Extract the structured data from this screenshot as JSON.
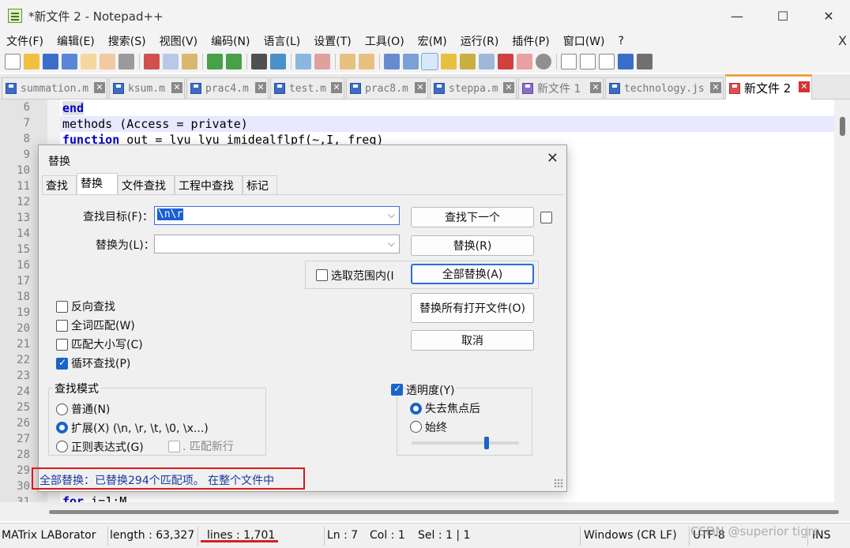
{
  "window": {
    "title": "*新文件 2 - Notepad++",
    "minimize": "—",
    "maximize": "☐",
    "close": "✕"
  },
  "menu": {
    "items": [
      "文件(F)",
      "编辑(E)",
      "搜索(S)",
      "视图(V)",
      "编码(N)",
      "语言(L)",
      "设置(T)",
      "工具(O)",
      "宏(M)",
      "运行(R)",
      "插件(P)",
      "窗口(W)",
      "?"
    ],
    "close": "X"
  },
  "tabs": [
    {
      "label": "summation.m"
    },
    {
      "label": "ksum.m"
    },
    {
      "label": "prac4.m"
    },
    {
      "label": "test.m"
    },
    {
      "label": "prac8.m"
    },
    {
      "label": "steppa.m"
    },
    {
      "label": "新文件 1"
    },
    {
      "label": "technology.js"
    },
    {
      "label": "新文件 2"
    }
  ],
  "tab_close": "✕",
  "editor": {
    "line_numbers": [
      "6",
      "7",
      "8",
      "9",
      "10",
      "11",
      "12",
      "13",
      "14",
      "15",
      "16",
      "17",
      "18",
      "19",
      "20",
      "21",
      "22",
      "23",
      "24",
      "25",
      "26",
      "27",
      "28",
      "29",
      "30",
      "31"
    ],
    "line6_kw": "end",
    "line7": "methods (Access = private)",
    "line8_kw": "function",
    "line8_rest": " out = lyu_lyu_imidealflpf(~,I, freq)",
    "line31_kw": "for",
    "line31_rest": " i=1:M"
  },
  "dialog": {
    "title": "替换",
    "close": "✕",
    "tabs": [
      "查找",
      "替换",
      "文件查找",
      "工程中查找",
      "标记"
    ],
    "find_label": "查找目标(F)：",
    "find_value": "\\n\\r",
    "replace_label": "替换为(L)：",
    "replace_value": "",
    "combo_arrow": "⌵",
    "btn_find_next": "查找下一个",
    "btn_replace": "替换(R)",
    "btn_replace_all": "全部替换(A)",
    "btn_replace_all_open": "替换所有打开文件(O)",
    "btn_cancel": "取消",
    "in_selection": "选取范围内(I",
    "opt_backward": "反向查找",
    "opt_whole_word": "全词匹配(W)",
    "opt_match_case": "匹配大小写(C)",
    "opt_wrap": "循环查找(P)",
    "search_mode_title": "查找模式",
    "mode_normal": "普通(N)",
    "mode_extended": "扩展(X) (\\n, \\r, \\t, \\0, \\x...)",
    "mode_regex": "正则表达式(G)",
    "match_newline": ". 匹配新行",
    "transparency": "透明度(Y)",
    "trans_on_lose_focus": "失去焦点后",
    "trans_always": "始终",
    "status_message": "全部替换：已替换294个匹配项。 在整个文件中"
  },
  "statusbar": {
    "language": "MATrix LABorator",
    "length": "length : 63,327",
    "lines": "lines : 1,701",
    "ln": "Ln : 7",
    "col": "Col : 1",
    "sel": "Sel : 1 | 1",
    "eol": "Windows (CR LF)",
    "encoding": "UTF-8",
    "mode": "INS"
  },
  "watermark": "CSDN @superior tigre"
}
